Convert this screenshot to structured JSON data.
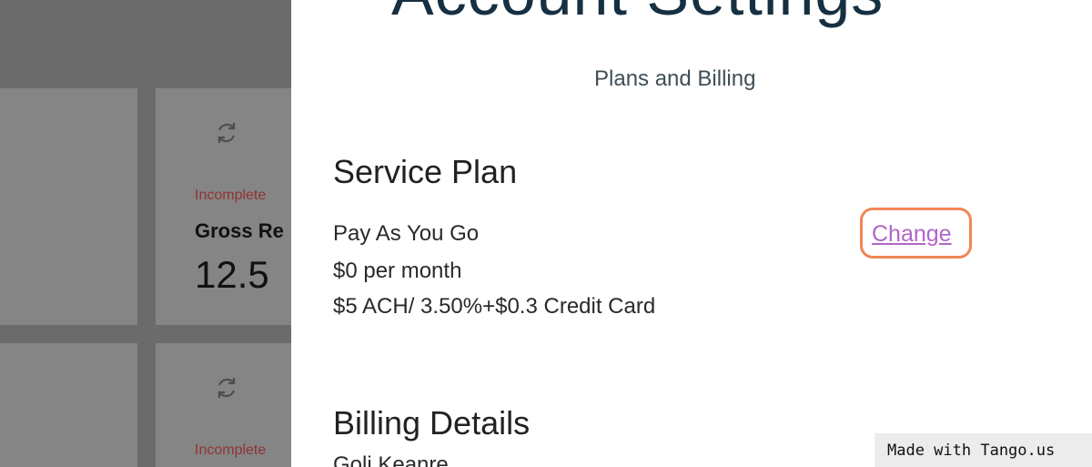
{
  "background": {
    "card_b": {
      "status": "Incomplete",
      "title": "Gross Re",
      "value": "12.5"
    },
    "card_d": {
      "status": "Incomplete"
    }
  },
  "panel": {
    "title": "Account Settings",
    "subtitle": "Plans and Billing",
    "service_plan": {
      "heading": "Service Plan",
      "plan_name": "Pay As You Go",
      "price": "$0 per month",
      "fees": "$5 ACH/ 3.50%+$0.3 Credit Card",
      "change_label": "Change"
    },
    "billing": {
      "heading": "Billing Details",
      "name": "Goli Keanre"
    }
  },
  "watermark": "Made with Tango.us",
  "colors": {
    "highlight": "#f08655",
    "link": "#b266c7",
    "title": "#163042"
  }
}
